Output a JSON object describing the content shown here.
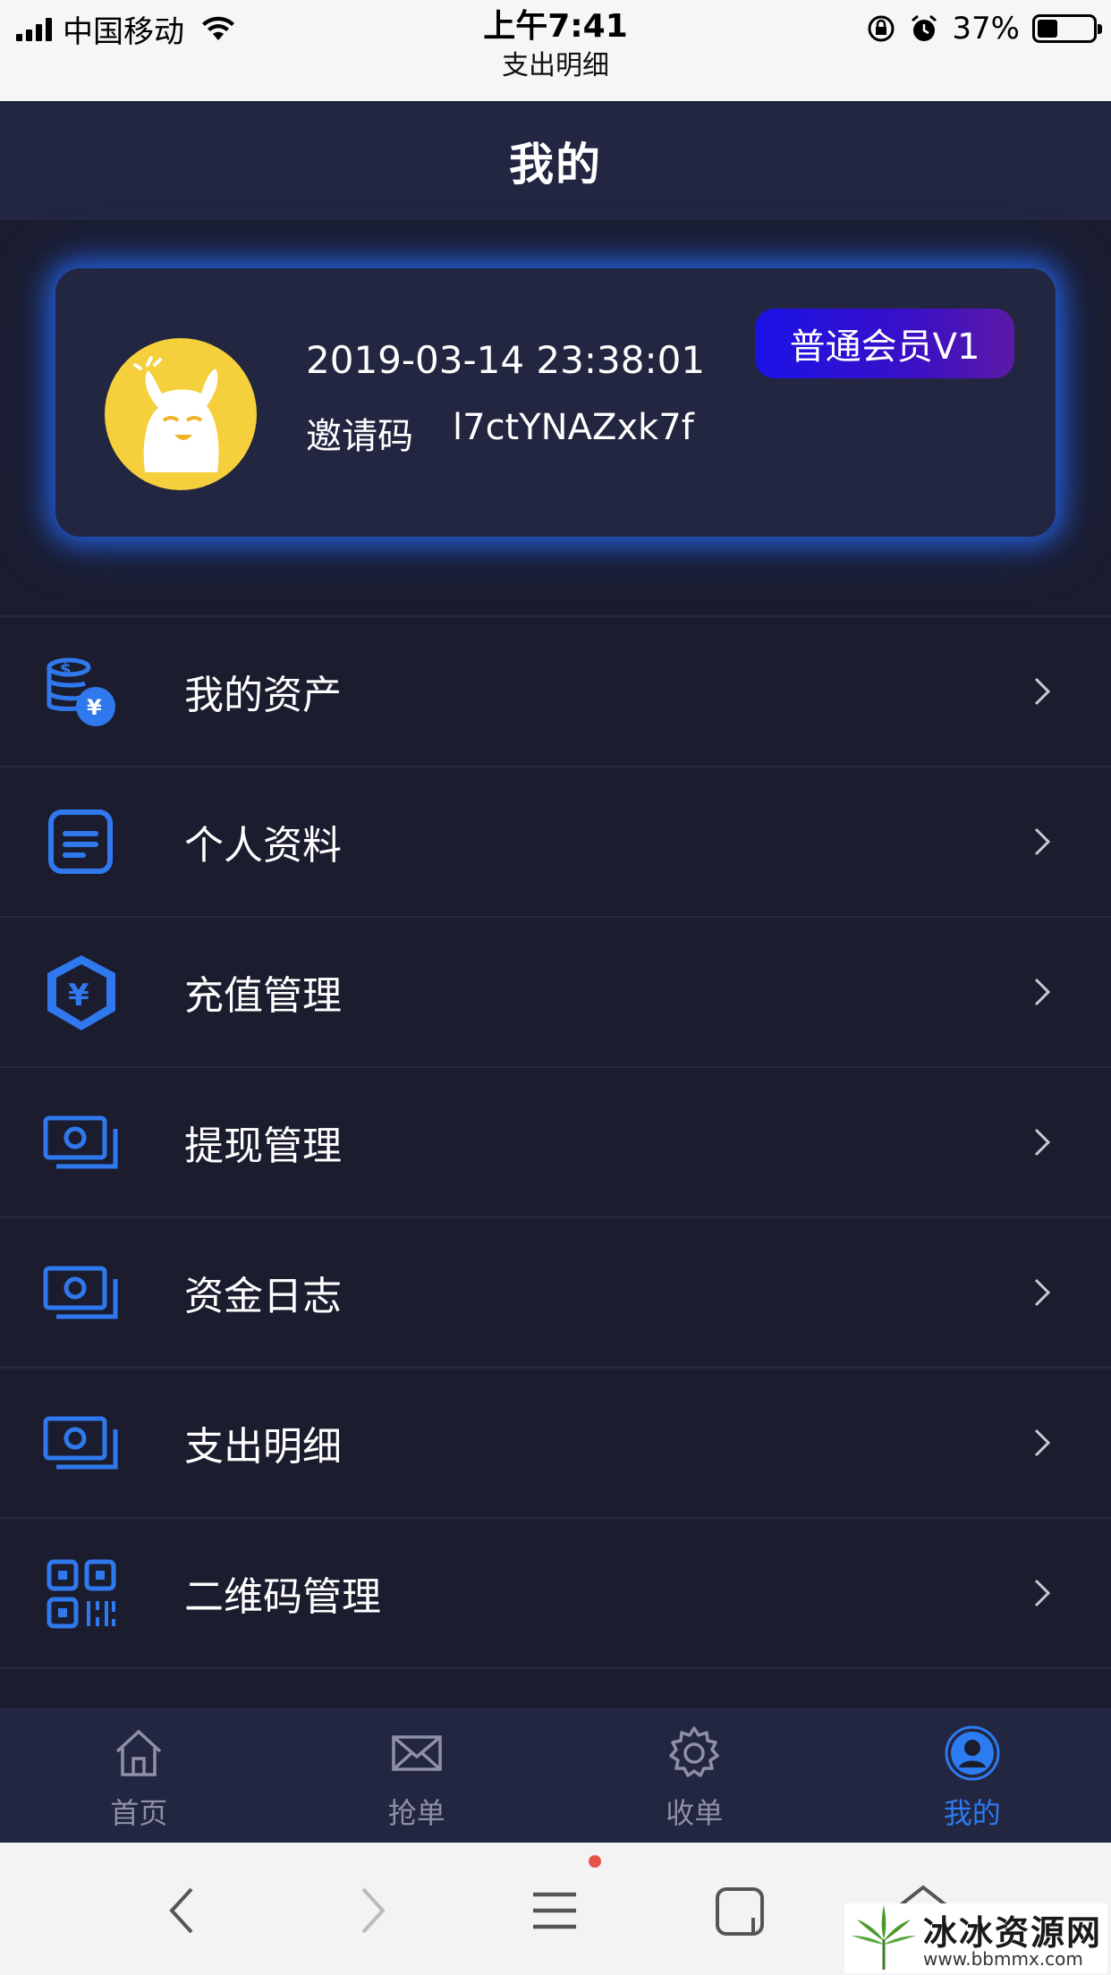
{
  "status_bar": {
    "carrier": "中国移动",
    "time": "上午7:41",
    "page_name": "支出明细",
    "battery_percent": "37%",
    "battery_level": 0.37,
    "icons": [
      "signal-icon",
      "wifi-icon",
      "rotation-lock-icon",
      "alarm-icon",
      "battery-icon"
    ]
  },
  "header": {
    "title": "我的"
  },
  "profile": {
    "datetime": "2019-03-14 23:38:01",
    "invite_label": "邀请码",
    "invite_code": "l7ctYNAZxk7f",
    "member_level": "普通会员V1"
  },
  "menu": {
    "items": [
      {
        "label": "我的资产",
        "icon": "coins-yen-icon"
      },
      {
        "label": "个人资料",
        "icon": "document-icon"
      },
      {
        "label": "充值管理",
        "icon": "shield-yen-icon"
      },
      {
        "label": "提现管理",
        "icon": "cash-icon"
      },
      {
        "label": "资金日志",
        "icon": "cash-icon"
      },
      {
        "label": "支出明细",
        "icon": "cash-icon"
      },
      {
        "label": "二维码管理",
        "icon": "qr-code-icon"
      }
    ]
  },
  "tabbar": {
    "tabs": [
      {
        "label": "首页",
        "icon": "home-icon",
        "active": false
      },
      {
        "label": "抢单",
        "icon": "mail-icon",
        "active": false
      },
      {
        "label": "收单",
        "icon": "gear-icon",
        "active": false
      },
      {
        "label": "我的",
        "icon": "user-icon",
        "active": true
      }
    ]
  },
  "browser_bar": {
    "buttons": [
      "back-icon",
      "forward-icon",
      "menu-icon",
      "tabs-icon",
      "home-icon"
    ]
  },
  "watermark": {
    "title": "冰冰资源网",
    "url": "www.bbmmx.com"
  },
  "colors": {
    "background": "#1b1d2f",
    "panel": "#222640",
    "accent": "#2c7bf0",
    "badge_start": "#1a13e6",
    "badge_end": "#5b1aa6",
    "avatar": "#f5cf3c"
  }
}
